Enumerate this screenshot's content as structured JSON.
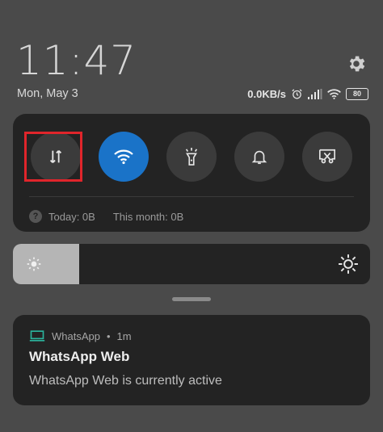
{
  "header": {
    "time": "11:47",
    "date": "Mon, May 3",
    "network_speed": "0.0KB/s",
    "battery": "80"
  },
  "icons": {
    "settings": "gear-icon",
    "alarm": "alarm-clock-icon",
    "signal": "cellular-signal-icon",
    "wifi": "wifi-icon",
    "battery": "battery-icon"
  },
  "quick_settings": {
    "toggles": [
      {
        "name": "mobile-data",
        "icon": "data-arrows-icon",
        "active": false,
        "highlighted": true
      },
      {
        "name": "wifi",
        "icon": "wifi-icon",
        "active": true
      },
      {
        "name": "flashlight",
        "icon": "flashlight-icon",
        "active": false
      },
      {
        "name": "sound",
        "icon": "bell-icon",
        "active": false
      },
      {
        "name": "screenshot",
        "icon": "scissors-screenshot-icon",
        "active": false
      }
    ],
    "usage_today": "Today: 0B",
    "usage_month": "This month: 0B"
  },
  "brightness": {
    "level": 0.185
  },
  "notification": {
    "app": "WhatsApp",
    "time": "1m",
    "title": "WhatsApp Web",
    "body": "WhatsApp Web is currently active"
  },
  "colors": {
    "accent": "#1a73c8",
    "highlight": "#e0252b",
    "whatsapp_icon": "#2bb39c"
  }
}
